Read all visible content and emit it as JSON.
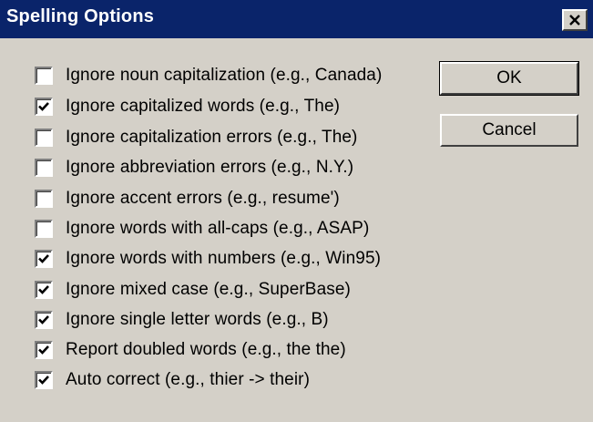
{
  "window": {
    "title": "Spelling Options",
    "close_label": "close"
  },
  "options": [
    {
      "label": "Ignore noun capitalization (e.g., Canada)",
      "checked": false
    },
    {
      "label": "Ignore capitalized words (e.g., The)",
      "checked": true
    },
    {
      "label": "Ignore capitalization errors (e.g., The)",
      "checked": false
    },
    {
      "label": "Ignore abbreviation errors (e.g., N.Y.)",
      "checked": false
    },
    {
      "label": "Ignore accent errors (e.g., resume')",
      "checked": false
    },
    {
      "label": "Ignore words with all-caps (e.g., ASAP)",
      "checked": false
    },
    {
      "label": "Ignore words with numbers (e.g., Win95)",
      "checked": true
    },
    {
      "label": "Ignore mixed case (e.g., SuperBase)",
      "checked": true
    },
    {
      "label": "Ignore single letter words (e.g., B)",
      "checked": true
    },
    {
      "label": "Report doubled words (e.g., the the)",
      "checked": true
    },
    {
      "label": "Auto correct (e.g., thier -> their)",
      "checked": true
    }
  ],
  "buttons": {
    "ok_label": "OK",
    "cancel_label": "Cancel"
  },
  "colors": {
    "titlebar": "#0a246a",
    "dialog_bg": "#d4d0c8"
  }
}
